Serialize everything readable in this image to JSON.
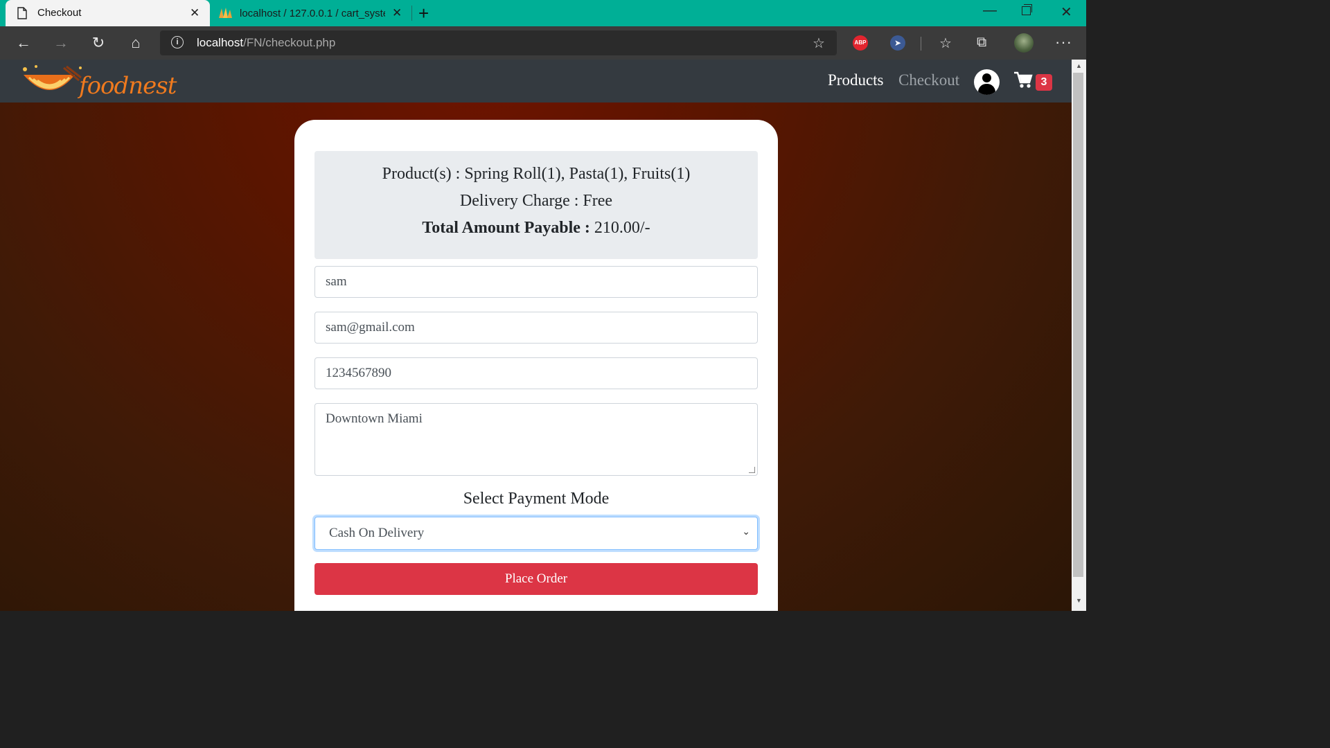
{
  "browser": {
    "tabs": [
      {
        "title": "Checkout",
        "active": true
      },
      {
        "title": "localhost / 127.0.0.1 / cart_system",
        "active": false
      }
    ],
    "url_host": "localhost",
    "url_path": "/FN/checkout.php",
    "extensions": {
      "abp_label": "ABP"
    }
  },
  "site": {
    "logo_text": "foodnest",
    "nav": {
      "products": "Products",
      "checkout": "Checkout",
      "cart_count": "3"
    }
  },
  "checkout": {
    "products_line": "Product(s) : Spring Roll(1), Pasta(1), Fruits(1)",
    "delivery_line": "Delivery Charge : Free",
    "total_label": "Total Amount Payable :",
    "total_value": "210.00/-",
    "name_value": "sam",
    "email_value": "sam@gmail.com",
    "phone_value": "1234567890",
    "address_value": "Downtown Miami",
    "payment_label": "Select Payment Mode",
    "payment_selected": "Cash On Delivery",
    "submit_label": "Place Order"
  },
  "colors": {
    "title_bar": "#00af96",
    "navbar": "#343a40",
    "accent_red": "#dc3545"
  }
}
